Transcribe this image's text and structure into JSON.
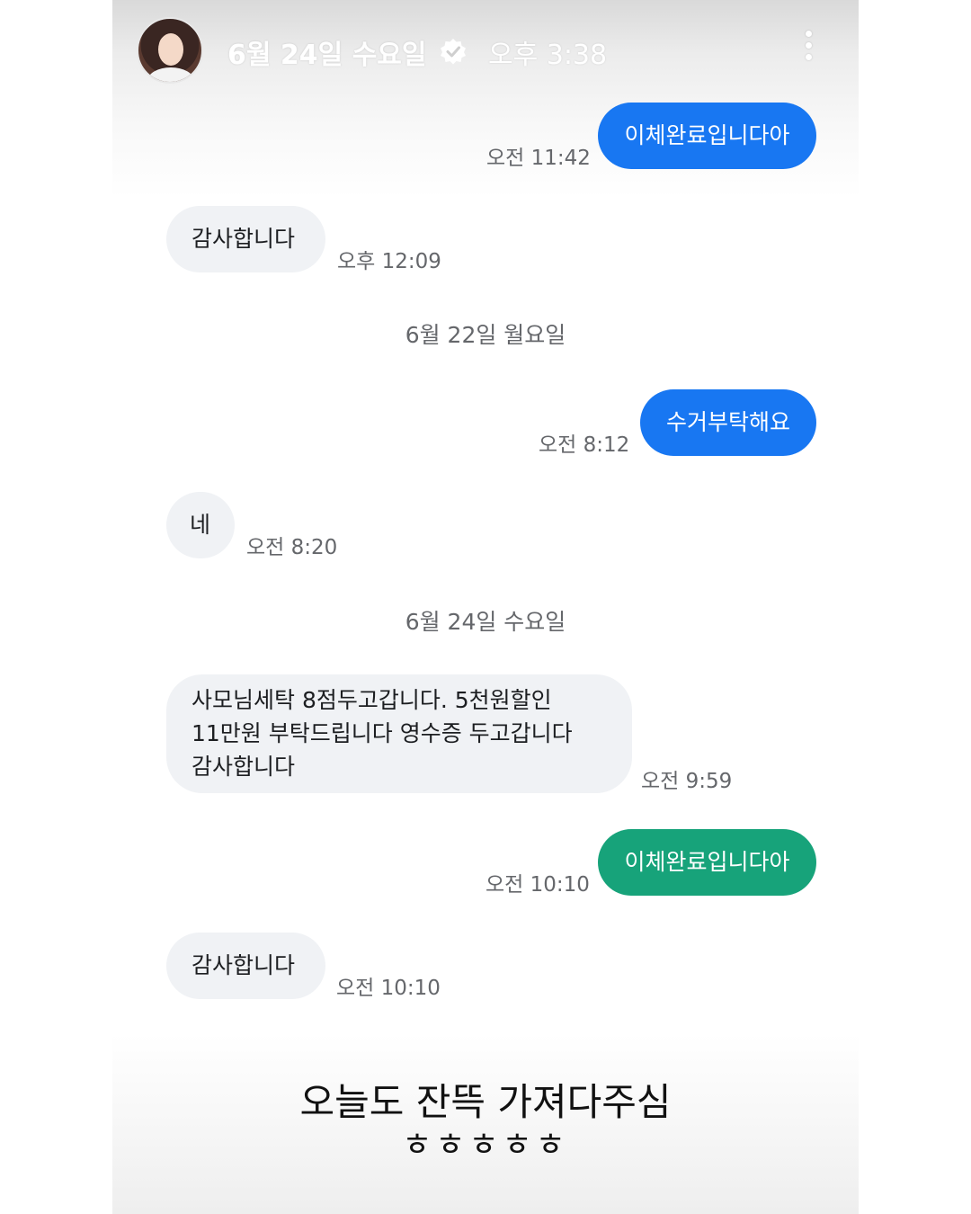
{
  "header": {
    "date": "6월 24일 수요일",
    "time": "오후 3:38",
    "verified_icon": "verified-badge-icon",
    "more_icon": "more-vertical-icon"
  },
  "messages": [
    {
      "side": "sent",
      "text": "이체완료입니다아",
      "time": "오전 11:42"
    },
    {
      "side": "recv",
      "text": "감사합니다",
      "time": "오후 12:09"
    },
    {
      "side": "divider",
      "text": "6월 22일 월요일"
    },
    {
      "side": "sent",
      "text": "수거부탁해요",
      "time": "오전 8:12"
    },
    {
      "side": "recv",
      "text": "네",
      "time": "오전 8:20"
    },
    {
      "side": "divider",
      "text": "6월 24일 수요일"
    },
    {
      "side": "recv",
      "lines": [
        "사모님세탁 8점두고갑니다. 5천원할인",
        "11만원 부탁드립니다  영수증 두고갑니다",
        "감사합니다"
      ],
      "time": "오전 9:59"
    },
    {
      "side": "sent",
      "text": "이체완료입니다아",
      "time": "오전 10:10"
    },
    {
      "side": "recv",
      "text": "감사합니다",
      "time": "오전 10:10"
    }
  ],
  "caption": {
    "line1": "오늘도 잔뜩 가져다주심",
    "line2": "ㅎㅎㅎㅎㅎ"
  },
  "colors": {
    "sent_bubble": "#1877f2",
    "sent_bubble_last": "#17a37a",
    "recv_bubble": "#f0f2f5",
    "timestamp": "#65676b"
  }
}
